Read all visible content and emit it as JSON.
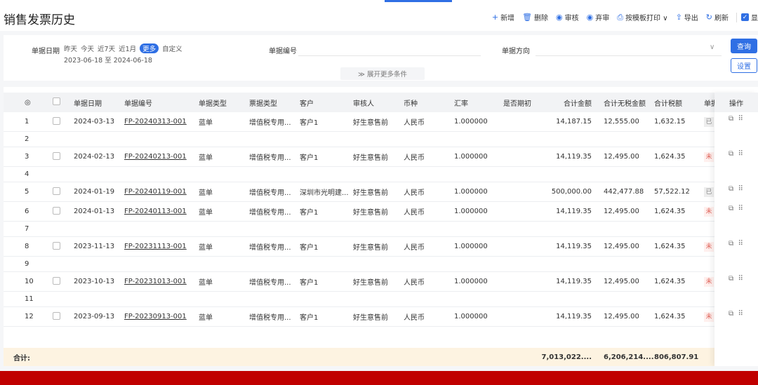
{
  "page": {
    "title": "销售发票历史"
  },
  "toolbar": [
    {
      "icon": "plus-icon",
      "glyph": "+",
      "label": "新增"
    },
    {
      "icon": "trash-icon",
      "glyph": "🗑",
      "label": "删除"
    },
    {
      "icon": "audit-icon",
      "glyph": "◉",
      "label": "审核"
    },
    {
      "icon": "unaudit-icon",
      "glyph": "◉",
      "label": "弃审"
    },
    {
      "icon": "print-icon",
      "glyph": "⎙",
      "label": "按模板打印 ∨"
    },
    {
      "icon": "export-icon",
      "glyph": "⇪",
      "label": "导出"
    },
    {
      "icon": "refresh-icon",
      "glyph": "↻",
      "label": "刷新"
    }
  ],
  "toolbar_extra": "显",
  "filters": {
    "date_label": "单据日期",
    "quick_dates": [
      "昨天",
      "今天",
      "近7天",
      "近1月",
      "更多",
      "自定义"
    ],
    "active_quick": "更多",
    "date_range": "2023-06-18 至 2024-06-18",
    "doc_no_label": "单据编号",
    "direction_label": "单据方向",
    "query_label": "查询",
    "settings_label": "设置",
    "expand_label": "≫ 展开更多条件"
  },
  "table": {
    "columns": [
      "◎",
      "",
      "单据日期",
      "单据编号",
      "单据类型",
      "票据类型",
      "客户",
      "审核人",
      "币种",
      "汇率",
      "是否期初",
      "合计金额",
      "合计无税金额",
      "合计税额",
      "单据",
      "操作"
    ],
    "rows": [
      {
        "no": "1",
        "date": "2024-03-13",
        "code": "FP-20240313-001",
        "type": "蓝单",
        "bill": "增值税专用...",
        "customer": "客户1",
        "auditor": "好生意售前",
        "currency": "人民币",
        "rate": "1.000000",
        "total": "14,187.15",
        "notax": "12,555.00",
        "tax": "1,632.15",
        "status": "已"
      },
      {
        "no": "2"
      },
      {
        "no": "3",
        "date": "2024-02-13",
        "code": "FP-20240213-001",
        "type": "蓝单",
        "bill": "增值税专用...",
        "customer": "客户1",
        "auditor": "好生意售前",
        "currency": "人民币",
        "rate": "1.000000",
        "total": "14,119.35",
        "notax": "12,495.00",
        "tax": "1,624.35",
        "status": "未"
      },
      {
        "no": "4"
      },
      {
        "no": "5",
        "date": "2024-01-19",
        "code": "FP-20240119-001",
        "type": "蓝单",
        "bill": "增值税专用...",
        "customer": "深圳市光明建...",
        "auditor": "好生意售前",
        "currency": "人民币",
        "rate": "1.000000",
        "total": "500,000.00",
        "notax": "442,477.88",
        "tax": "57,522.12",
        "status": "已"
      },
      {
        "no": "6",
        "date": "2024-01-13",
        "code": "FP-20240113-001",
        "type": "蓝单",
        "bill": "增值税专用...",
        "customer": "客户1",
        "auditor": "好生意售前",
        "currency": "人民币",
        "rate": "1.000000",
        "total": "14,119.35",
        "notax": "12,495.00",
        "tax": "1,624.35",
        "status": "未"
      },
      {
        "no": "7"
      },
      {
        "no": "8",
        "date": "2023-11-13",
        "code": "FP-20231113-001",
        "type": "蓝单",
        "bill": "增值税专用...",
        "customer": "客户1",
        "auditor": "好生意售前",
        "currency": "人民币",
        "rate": "1.000000",
        "total": "14,119.35",
        "notax": "12,495.00",
        "tax": "1,624.35",
        "status": "未"
      },
      {
        "no": "9"
      },
      {
        "no": "10",
        "date": "2023-10-13",
        "code": "FP-20231013-001",
        "type": "蓝单",
        "bill": "增值税专用...",
        "customer": "客户1",
        "auditor": "好生意售前",
        "currency": "人民币",
        "rate": "1.000000",
        "total": "14,119.35",
        "notax": "12,495.00",
        "tax": "1,624.35",
        "status": "未"
      },
      {
        "no": "11"
      },
      {
        "no": "12",
        "date": "2023-09-13",
        "code": "FP-20230913-001",
        "type": "蓝单",
        "bill": "增值税专用...",
        "customer": "客户1",
        "auditor": "好生意售前",
        "currency": "人民币",
        "rate": "1.000000",
        "total": "14,119.35",
        "notax": "12,495.00",
        "tax": "1,624.35",
        "status": "未"
      }
    ],
    "footer": {
      "label": "合计:",
      "total": "7,013,022....",
      "notax": "6,206,214....",
      "tax": "806,807.91"
    }
  },
  "colors": {
    "accent": "#2f6fe4",
    "footer_bg": "#fdf3e1",
    "bottom_bar": "#c00000"
  }
}
